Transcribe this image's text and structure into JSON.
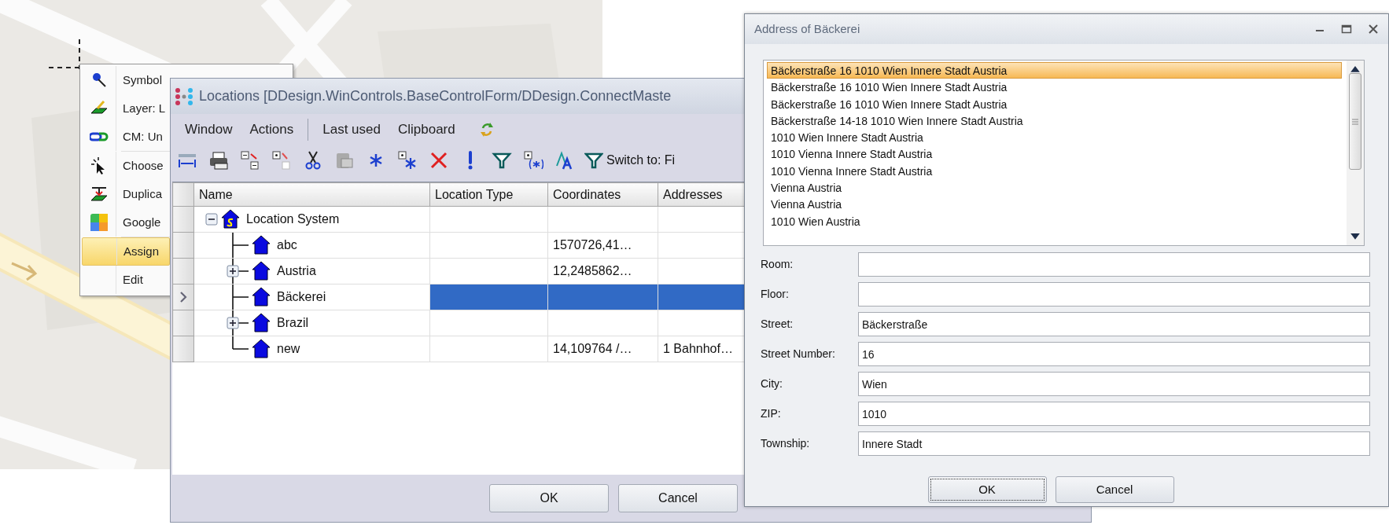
{
  "context_menu": {
    "items": [
      {
        "kind": "item",
        "label": "Symbol",
        "selected": false
      },
      {
        "kind": "item",
        "label": "Layer: L",
        "selected": false
      },
      {
        "kind": "item",
        "label": "CM: Un",
        "selected": false
      },
      {
        "kind": "separator"
      },
      {
        "kind": "item",
        "label": "Choose",
        "selected": false
      },
      {
        "kind": "item",
        "label": "Duplica",
        "selected": false
      },
      {
        "kind": "item",
        "label": "Google",
        "selected": false
      },
      {
        "kind": "separator"
      },
      {
        "kind": "item",
        "label": "Assign",
        "selected": true
      },
      {
        "kind": "item",
        "label": "Edit",
        "selected": false
      }
    ]
  },
  "locations_window": {
    "title": "Locations [DDesign.WinControls.BaseControlForm/DDesign.ConnectMaste",
    "menu": [
      {
        "kind": "item",
        "label": "Window"
      },
      {
        "kind": "item",
        "label": "Actions"
      },
      {
        "kind": "separator"
      },
      {
        "kind": "item",
        "label": "Last used"
      },
      {
        "kind": "item",
        "label": "Clipboard"
      }
    ],
    "switch_button": "Switch to: Fi",
    "columns": [
      "Name",
      "Location Type",
      "Coordinates",
      "Addresses"
    ],
    "tree": [
      {
        "name": "Location System",
        "kind": "system",
        "expandable": true,
        "expanded": true,
        "selected": false,
        "children": [
          {
            "name": "abc",
            "kind": "location",
            "expandable": false,
            "selected": false,
            "coordinates": "1570726,41…"
          },
          {
            "name": "Austria",
            "kind": "location",
            "expandable": true,
            "expanded": false,
            "selected": false,
            "coordinates": "12,2485862…"
          },
          {
            "name": "Bäckerei",
            "kind": "location",
            "expandable": false,
            "selected": true
          },
          {
            "name": "Brazil",
            "kind": "location",
            "expandable": true,
            "expanded": false,
            "selected": false
          },
          {
            "name": "new",
            "kind": "location",
            "expandable": false,
            "selected": false,
            "coordinates": "14,109764 /…",
            "addresses": "1 Bahnhof…"
          }
        ]
      }
    ],
    "buttons": [
      "OK",
      "Cancel"
    ]
  },
  "address_dialog": {
    "title": "Address of Bäckerei",
    "addresses": [
      {
        "text": "Bäckerstraße 16 1010 Wien Innere Stadt Austria",
        "selected": true
      },
      {
        "text": "Bäckerstraße 16 1010 Wien Innere Stadt Austria",
        "selected": false
      },
      {
        "text": "Bäckerstraße 16 1010 Wien Innere Stadt Austria",
        "selected": false
      },
      {
        "text": "Bäckerstraße 14-18 1010 Wien Innere Stadt Austria",
        "selected": false
      },
      {
        "text": "1010 Wien Innere Stadt Austria",
        "selected": false
      },
      {
        "text": "1010 Vienna Innere Stadt Austria",
        "selected": false
      },
      {
        "text": "1010 Vienna Innere Stadt Austria",
        "selected": false
      },
      {
        "text": "Vienna Austria",
        "selected": false
      },
      {
        "text": "Vienna Austria",
        "selected": false
      },
      {
        "text": "1010 Wien Austria",
        "selected": false
      }
    ],
    "fields": [
      {
        "label": "Room:"
      },
      {
        "label": "Floor:"
      },
      {
        "label": "Street:",
        "value": "Bäckerstraße"
      },
      {
        "label": "Street Number:",
        "value": "16"
      },
      {
        "label": "City:",
        "value": "Wien"
      },
      {
        "label": "ZIP:",
        "value": "1010"
      },
      {
        "label": "Township:",
        "value": "Innere Stadt"
      }
    ],
    "buttons": [
      {
        "label": "OK",
        "focused": true
      },
      {
        "label": "Cancel",
        "focused": false
      }
    ]
  }
}
